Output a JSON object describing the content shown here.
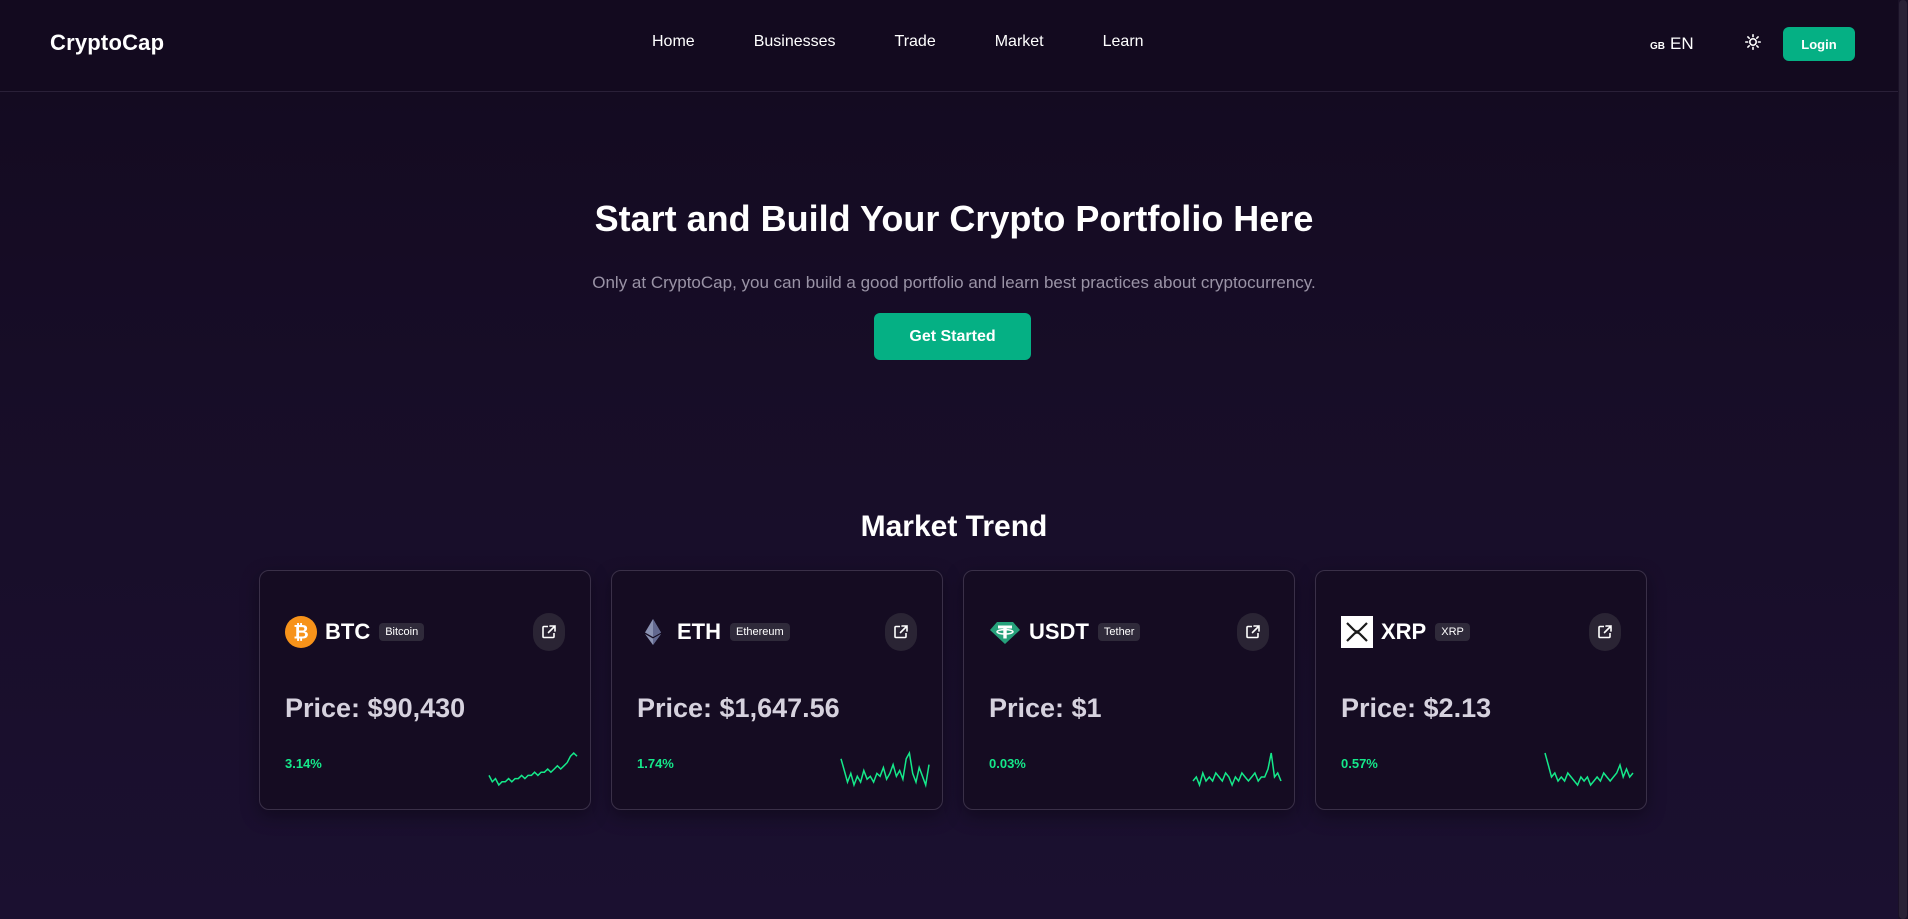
{
  "header": {
    "brand": "CryptoCap",
    "nav": [
      "Home",
      "Businesses",
      "Trade",
      "Market",
      "Learn"
    ],
    "language_flag": "GB",
    "language": "EN",
    "theme_icon": "sun-icon",
    "login_label": "Login"
  },
  "hero": {
    "title": "Start and Build Your Crypto Portfolio Here",
    "subtitle": "Only at CryptoCap, you can build a good portfolio and learn best practices about cryptocurrency.",
    "cta_label": "Get Started"
  },
  "market_trend": {
    "title": "Market Trend",
    "cards": [
      {
        "symbol": "BTC",
        "name": "Bitcoin",
        "price": "Price: $90,430",
        "change": "3.14%",
        "icon": "bitcoin-icon",
        "spark": [
          6,
          4,
          5,
          3,
          4,
          4,
          5,
          4,
          5,
          5,
          6,
          5,
          6,
          6,
          7,
          6,
          7,
          7,
          8,
          7,
          8,
          9,
          8,
          9,
          10,
          12,
          13,
          12
        ]
      },
      {
        "symbol": "ETH",
        "name": "Ethereum",
        "price": "Price: $1,647.56",
        "change": "1.74%",
        "icon": "ethereum-icon",
        "spark": [
          12,
          8,
          4,
          7,
          3,
          6,
          4,
          8,
          5,
          6,
          4,
          7,
          6,
          9,
          5,
          7,
          10,
          6,
          8,
          5,
          12,
          14,
          7,
          4,
          9,
          6,
          3,
          10
        ]
      },
      {
        "symbol": "USDT",
        "name": "Tether",
        "price": "Price: $1",
        "change": "0.03%",
        "icon": "tether-icon",
        "spark": [
          5,
          6,
          4,
          7,
          5,
          6,
          5,
          7,
          6,
          5,
          7,
          6,
          4,
          6,
          5,
          7,
          6,
          5,
          6,
          7,
          5,
          6,
          6,
          8,
          12,
          6,
          7,
          5
        ]
      },
      {
        "symbol": "XRP",
        "name": "XRP",
        "price": "Price: $2.13",
        "change": "0.57%",
        "icon": "xrp-icon",
        "spark": [
          12,
          9,
          6,
          7,
          5,
          6,
          5,
          7,
          6,
          5,
          4,
          6,
          5,
          6,
          4,
          5,
          6,
          5,
          7,
          6,
          5,
          6,
          7,
          9,
          6,
          8,
          6,
          7
        ]
      }
    ]
  },
  "colors": {
    "accent": "#05b084",
    "positive": "#15e88a",
    "background": "#130a1f"
  }
}
